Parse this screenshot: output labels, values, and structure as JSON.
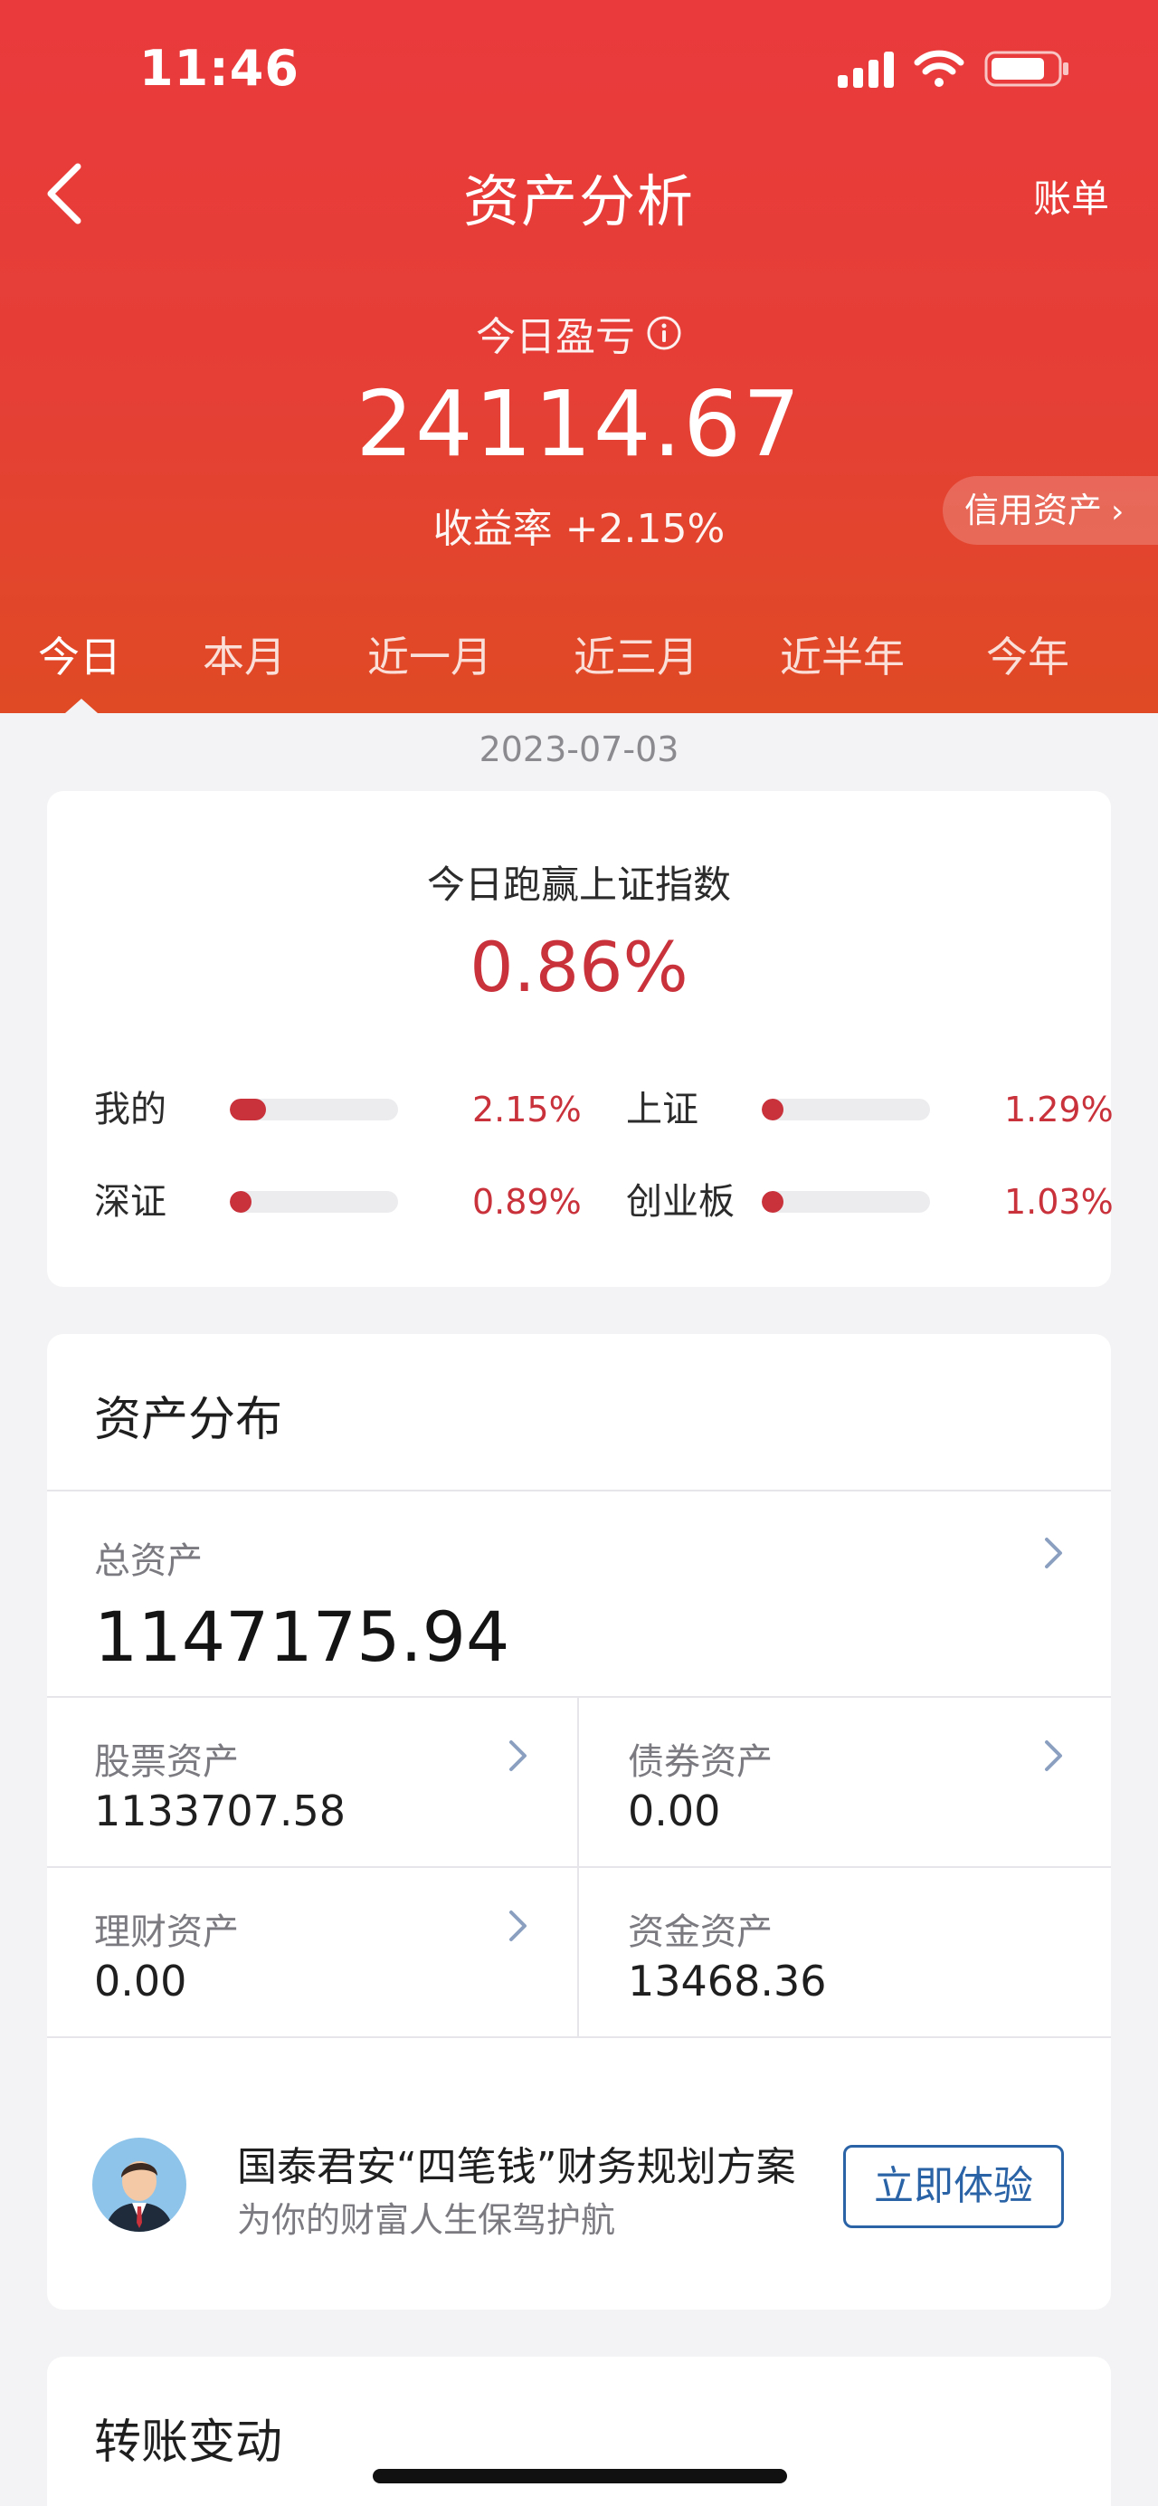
{
  "status_bar": {
    "time": "11:46"
  },
  "nav": {
    "title": "资产分析",
    "right_action": "账单"
  },
  "summary": {
    "today_pl_label": "今日盈亏",
    "today_pl_value": "24114.67",
    "yield_rate_text": "收益率 +2.15%",
    "credit_assets_label": "信用资产"
  },
  "tabs": [
    {
      "label": "今日",
      "active": true
    },
    {
      "label": "本月"
    },
    {
      "label": "近一月"
    },
    {
      "label": "近三月"
    },
    {
      "label": "近半年"
    },
    {
      "label": "今年"
    }
  ],
  "date": "2023-07-03",
  "outperform": {
    "title": "今日跑赢上证指数",
    "value": "0.86%",
    "items": [
      {
        "name": "我的",
        "value": "2.15%",
        "level": 2.15
      },
      {
        "name": "上证",
        "value": "1.29%",
        "level": 1.29
      },
      {
        "name": "深证",
        "value": "0.89%",
        "level": 0.89
      },
      {
        "name": "创业板",
        "value": "1.03%",
        "level": 1.03
      }
    ]
  },
  "assets": {
    "title": "资产分布",
    "total_label": "总资产",
    "total_value": "1147175.94",
    "cells": [
      {
        "label": "股票资产",
        "value": "1133707.58"
      },
      {
        "label": "债券资产",
        "value": "0.00"
      },
      {
        "label": "理财资产",
        "value": "0.00"
      },
      {
        "label": "资金资产",
        "value": "13468.36"
      }
    ],
    "promo": {
      "title": "国泰君安“四笔钱”财务规划方案",
      "subtitle": "为你的财富人生保驾护航",
      "button": "立即体验"
    }
  },
  "transfer": {
    "title": "转账变动"
  },
  "colors": {
    "header_red": "#e53f36",
    "accent_red": "#c9313b",
    "link_blue": "#2a63a6"
  }
}
